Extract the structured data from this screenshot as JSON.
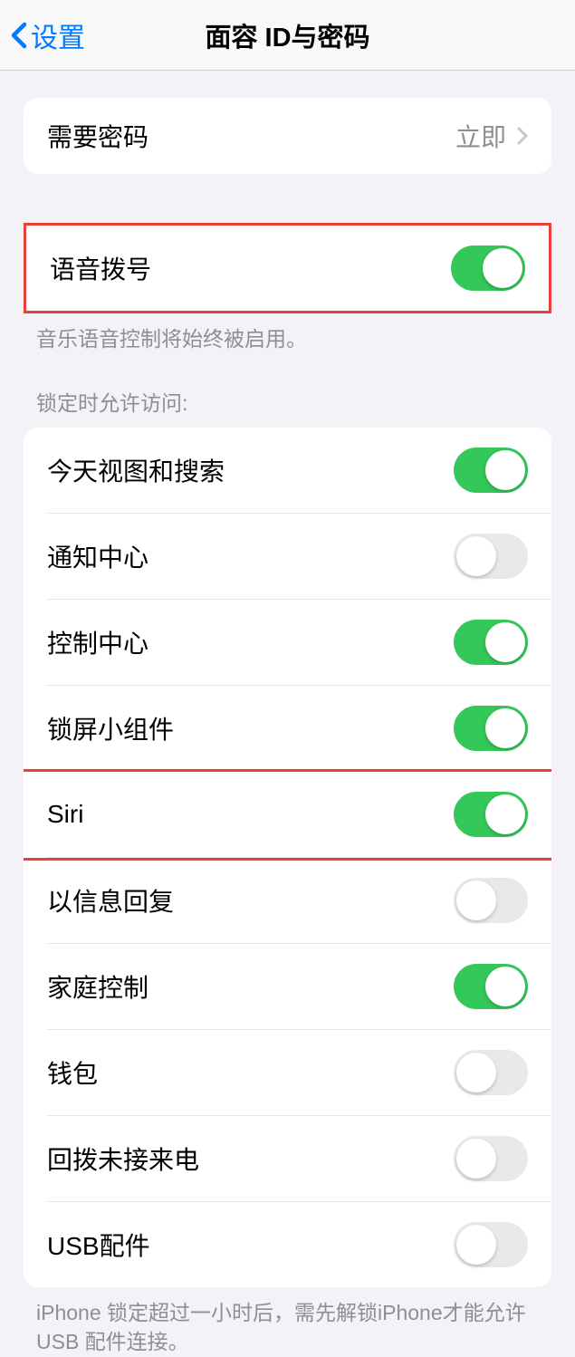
{
  "nav": {
    "back_label": "设置",
    "title": "面容 ID与密码"
  },
  "passcode_section": {
    "require_passcode_label": "需要密码",
    "require_passcode_value": "立即"
  },
  "voice_dial": {
    "label": "语音拨号",
    "footer": "音乐语音控制将始终被启用。"
  },
  "lock_access": {
    "header": "锁定时允许访问:",
    "items": [
      {
        "label": "今天视图和搜索",
        "on": true
      },
      {
        "label": "通知中心",
        "on": false
      },
      {
        "label": "控制中心",
        "on": true
      },
      {
        "label": "锁屏小组件",
        "on": true
      },
      {
        "label": "Siri",
        "on": true
      },
      {
        "label": "以信息回复",
        "on": false
      },
      {
        "label": "家庭控制",
        "on": true
      },
      {
        "label": "钱包",
        "on": false
      },
      {
        "label": "回拨未接来电",
        "on": false
      },
      {
        "label": "USB配件",
        "on": false
      }
    ],
    "footer": "iPhone 锁定超过一小时后，需先解锁iPhone才能允许USB 配件连接。"
  }
}
